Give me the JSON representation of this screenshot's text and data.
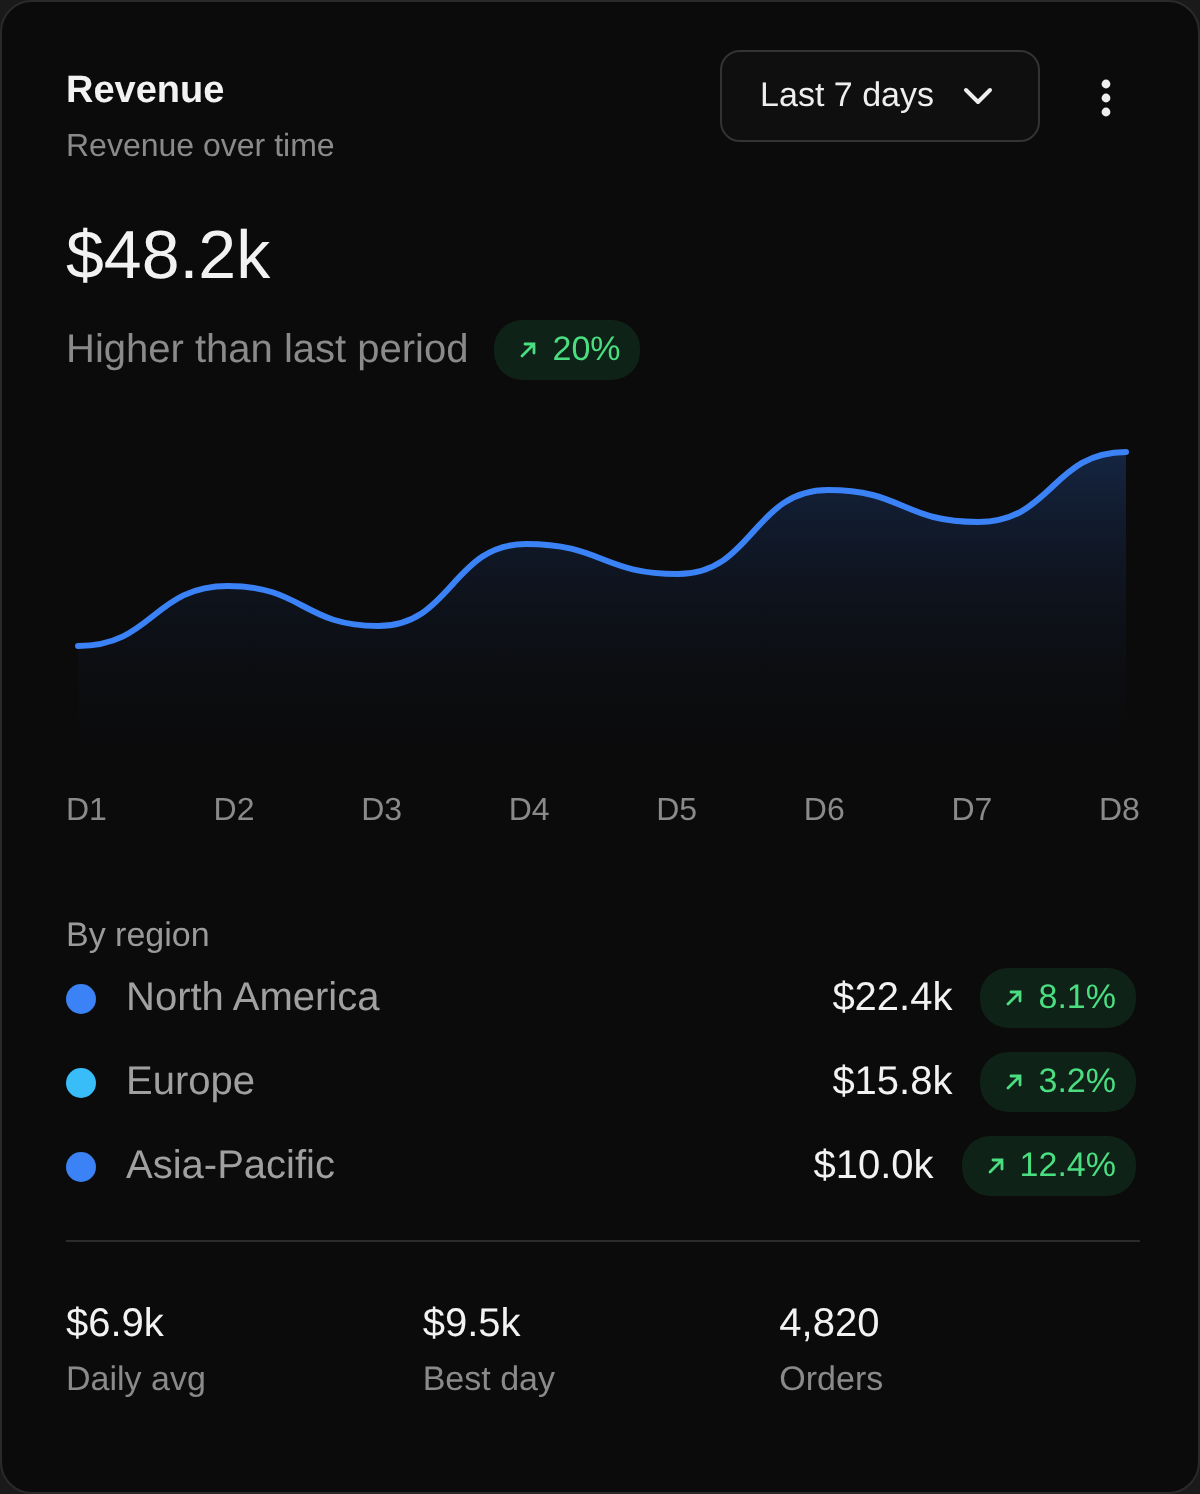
{
  "card": {
    "title": "Revenue",
    "subtitle": "Revenue over time",
    "period": "Last 7 days"
  },
  "summary": {
    "value": "$48.2k",
    "caption": "Higher than last period",
    "change": "20%"
  },
  "chart": {
    "kind": "picture",
    "x_labels": [
      "D1",
      "D2",
      "D3",
      "D4",
      "D5",
      "D6",
      "D7",
      "D8"
    ]
  },
  "regions": {
    "heading": "By region",
    "items": [
      {
        "name": "North America",
        "value": "$22.4k",
        "change": "8.1%",
        "color": "#3b82f6"
      },
      {
        "name": "Europe",
        "value": "$15.8k",
        "change": "3.2%",
        "color": "#38bdf8"
      },
      {
        "name": "Asia-Pacific",
        "value": "$10.0k",
        "change": "12.4%",
        "color": "#3b82f6"
      }
    ]
  },
  "stats": [
    {
      "value": "$6.9k",
      "label": "Daily avg"
    },
    {
      "value": "$9.5k",
      "label": "Best day"
    },
    {
      "value": "4,820",
      "label": "Orders"
    }
  ]
}
